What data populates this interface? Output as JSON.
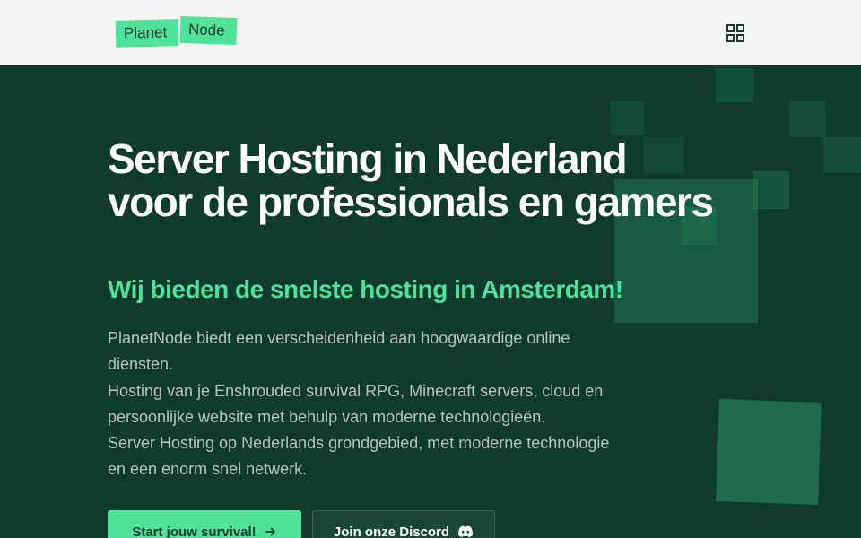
{
  "header": {
    "logo_part1": "Planet",
    "logo_part2": "Node",
    "menu_icon": "grid-menu-icon"
  },
  "hero": {
    "title": "Server Hosting in Nederland voor de professionals en gamers",
    "subtitle": "Wij bieden de snelste hosting in Amsterdam!",
    "description": [
      "PlanetNode biedt een verscheidenheid aan hoogwaardige online diensten.",
      "Hosting van je Enshrouded survival RPG, Minecraft servers, cloud en persoonlijke website met behulp van moderne technologieën.",
      "Server Hosting op Nederlands grondgebied, met moderne technologie en een enorm snel netwerk."
    ],
    "primary_button": "Start jouw survival!",
    "primary_button_icon": "arrow-right-icon",
    "secondary_button": "Join onze Discord",
    "secondary_button_icon": "discord-icon"
  },
  "colors": {
    "accent": "#4fe39a",
    "hero_background": "#0e3b2d",
    "header_background": "#f3f5f3",
    "text_muted": "#b7c4bd"
  }
}
